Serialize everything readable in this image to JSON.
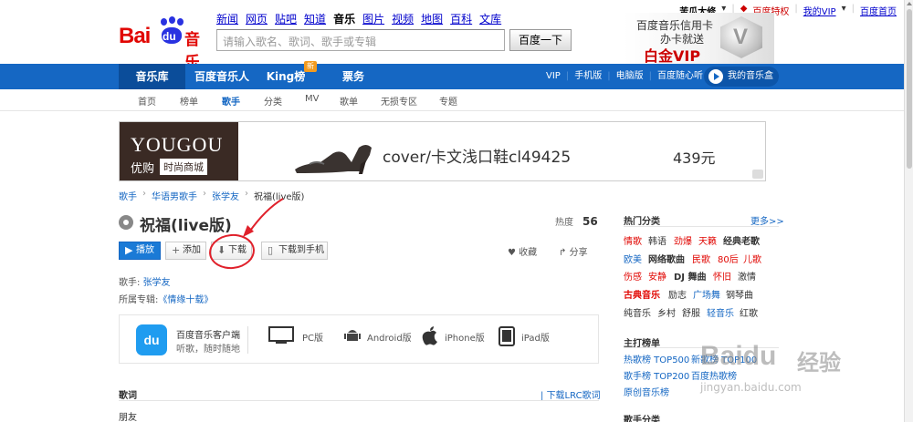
{
  "header": {
    "logo_text": "Baidu音乐",
    "logo_bai": "Bai",
    "logo_du": "du",
    "logo_yue": "音乐",
    "topnav": [
      "新闻",
      "网页",
      "贴吧",
      "知道",
      "音乐",
      "图片",
      "视频",
      "地图",
      "百科",
      "文库"
    ],
    "topnav_active": "音乐",
    "search_placeholder": "请输入歌名、歌词、歌手或专辑",
    "search_button": "百度一下",
    "user": {
      "name": "苦瓜大修",
      "privilege": "百度特权",
      "myvip": "我的VIP",
      "home": "百度首页"
    },
    "vip_ad": {
      "line1": "百度音乐信用卡",
      "line2": "办卡就送",
      "line3": "白金VIP",
      "badge": "V"
    }
  },
  "mainnav": {
    "items": [
      "音乐库",
      "百度音乐人",
      "King榜",
      "票务"
    ],
    "active": "音乐库",
    "new_badge": "新",
    "right_links": [
      "VIP",
      "手机版",
      "电脑版",
      "百度随心听"
    ],
    "mybox": "我的音乐盒"
  },
  "subnav": {
    "items": [
      "首页",
      "榜单",
      "歌手",
      "分类",
      "MV",
      "歌单",
      "无损专区",
      "专题"
    ],
    "active": "歌手"
  },
  "ad": {
    "brand": "YOUGOU",
    "brand_cn": "优购",
    "brand_tag": "时尚商城",
    "product": "cover/卡文浅口鞋cl49425",
    "price": "439元"
  },
  "breadcrumb": [
    "歌手",
    "华语男歌手",
    "张学友",
    "祝福(live版)"
  ],
  "song": {
    "title": "祝福(live版)",
    "hot_label": "热度",
    "hot_value": "56",
    "buttons": {
      "play": "播放",
      "add": "添加",
      "download": "下载",
      "download_phone": "下载到手机",
      "collect": "收藏",
      "share": "分享"
    },
    "singer_label": "歌手:",
    "singer": "张学友",
    "album_label": "所属专辑:",
    "album": "《情缘十载》"
  },
  "client": {
    "title": "百度音乐客户端",
    "subtitle": "听歌，随时随地",
    "platforms": [
      "PC版",
      "Android版",
      "iPhone版",
      "iPad版"
    ]
  },
  "lyrics": {
    "heading": "歌词",
    "download_lrc": "下载LRC歌词",
    "first_line": "朋友"
  },
  "sidebar": {
    "hot_categories": "热门分类",
    "more": "更多>>",
    "tags": [
      [
        "情歌",
        "韩语",
        "劲爆",
        "天籁",
        "经典老歌"
      ],
      [
        "欧美",
        "网络歌曲",
        "民歌",
        "80后",
        "儿歌"
      ],
      [
        "伤感",
        "安静",
        "DJ 舞曲",
        "怀旧",
        "激情"
      ],
      [
        "古典音乐",
        "励志",
        "广场舞",
        "钢琴曲"
      ],
      [
        "纯音乐",
        "乡村",
        "舒服",
        "轻音乐",
        "红歌"
      ]
    ],
    "charts_heading": "主打榜单",
    "charts": [
      [
        "热歌榜 TOP500",
        "新歌榜 TOP100"
      ],
      [
        "歌手榜 TOP200",
        "百度热歌榜"
      ],
      [
        "原创音乐榜"
      ]
    ],
    "singers_heading": "歌手分类"
  },
  "watermark": {
    "logo": "Baidu",
    "cn": "经验",
    "url": "jingyan.baidu.com"
  }
}
